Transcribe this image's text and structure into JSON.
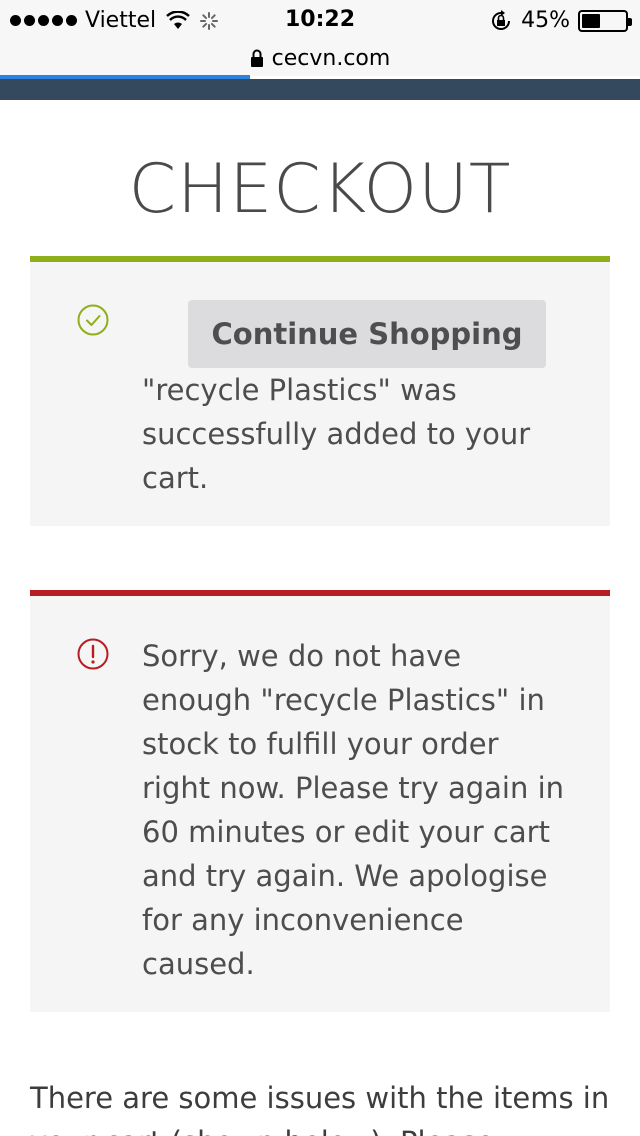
{
  "status_bar": {
    "carrier": "Viettel",
    "time": "10:22",
    "battery": "45%"
  },
  "browser": {
    "url": "cecvn.com",
    "load_progress": 0.39
  },
  "page": {
    "title": "CHECKOUT"
  },
  "success_notice": {
    "button_label": "Continue Shopping",
    "message": "\"recycle Plastics\" was successfully added to your cart.",
    "color": "#8fae1b"
  },
  "error_notice": {
    "message": "Sorry, we do not have enough \"recycle Plastics\" in stock to fulfill your order right now. Please try again in 60 minutes or edit your cart and try again. We apologise for any inconvenience caused.",
    "color": "#b81c23"
  },
  "issues": {
    "text": "There are some issues with the items in your cart (shown below). Please"
  }
}
